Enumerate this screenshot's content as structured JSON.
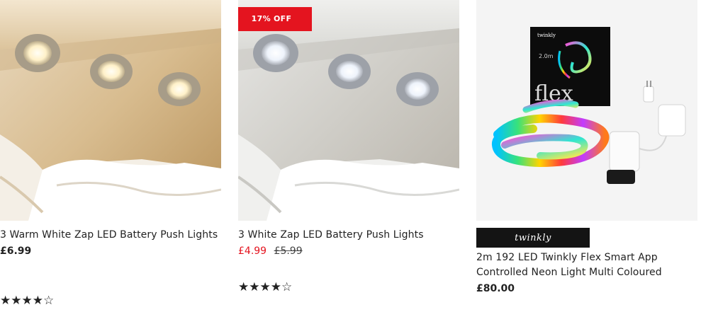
{
  "colors": {
    "sale_red": "#e4141f",
    "star_gold": "#f5b301",
    "brand_bg": "#141414"
  },
  "products": [
    {
      "title": "3 Warm White Zap LED Battery Push Lights",
      "price": "£6.99",
      "rating_stars": "★★★★☆"
    },
    {
      "badge": "17% OFF",
      "title": "3 White Zap LED Battery Push Lights",
      "price": "£4.99",
      "was_price": "£5.99",
      "rating_stars": "★★★★☆"
    },
    {
      "image_text": {
        "brand": "twinkly",
        "length": "2.0m",
        "name": "flex"
      },
      "brand_logo": "twinkly",
      "title": "2m 192 LED Twinkly Flex Smart App Controlled Neon Light Multi Coloured",
      "price": "£80.00"
    }
  ]
}
